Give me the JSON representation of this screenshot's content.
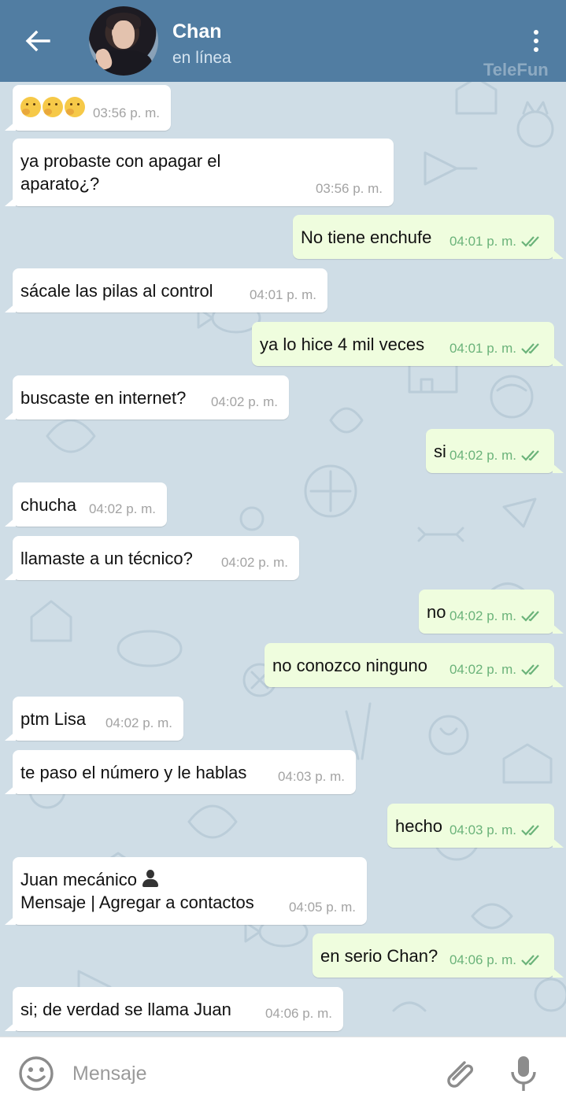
{
  "header": {
    "title": "Chan",
    "status": "en línea",
    "watermark": "TeleFun",
    "back_icon": "arrow-left-icon",
    "menu_icon": "more-vertical-icon"
  },
  "messages": [
    {
      "dir": "in",
      "emoji_count": 3,
      "text": "",
      "time": "03:56 p. m."
    },
    {
      "dir": "in",
      "text_lines": [
        "ya probaste con apagar el",
        "aparato¿?"
      ],
      "time": "03:56 p. m."
    },
    {
      "dir": "out",
      "text": "No tiene enchufe",
      "time": "04:01 p. m."
    },
    {
      "dir": "in",
      "text": "sácale las pilas al control",
      "time": "04:01 p. m."
    },
    {
      "dir": "out",
      "text": "ya lo hice 4 mil veces",
      "time": "04:01 p. m."
    },
    {
      "dir": "in",
      "text": "buscaste en internet?",
      "time": "04:02 p. m."
    },
    {
      "dir": "out",
      "text": "si",
      "time": "04:02 p. m."
    },
    {
      "dir": "in",
      "text": "chucha",
      "time": "04:02 p. m."
    },
    {
      "dir": "in",
      "text": "llamaste a un técnico?",
      "time": "04:02 p. m."
    },
    {
      "dir": "out",
      "text": "no",
      "time": "04:02 p. m."
    },
    {
      "dir": "out",
      "text": "no conozco ninguno",
      "time": "04:02 p. m."
    },
    {
      "dir": "in",
      "text": "ptm Lisa",
      "time": "04:02 p. m."
    },
    {
      "dir": "in",
      "text": "te paso el número y le hablas",
      "time": "04:03 p. m."
    },
    {
      "dir": "out",
      "text": "hecho",
      "time": "04:03 p. m."
    },
    {
      "dir": "in",
      "text_lines": [
        "Juan mecánico",
        "Mensaje | Agregar a contactos"
      ],
      "time": "04:05 p. m."
    },
    {
      "dir": "out",
      "text": "en serio Chan?",
      "time": "04:06 p. m."
    },
    {
      "dir": "in",
      "text": "si; de verdad se llama Juan",
      "time": "04:06 p. m."
    }
  ],
  "input": {
    "placeholder": "Mensaje",
    "emoji_icon": "smiley-icon",
    "attach_icon": "paperclip-icon",
    "mic_icon": "microphone-icon"
  },
  "colors": {
    "header": "#517da2",
    "chat_bg": "#cfdde6",
    "bubble_in": "#ffffff",
    "bubble_out": "#effdde",
    "read_ticks": "#6bb37a"
  }
}
